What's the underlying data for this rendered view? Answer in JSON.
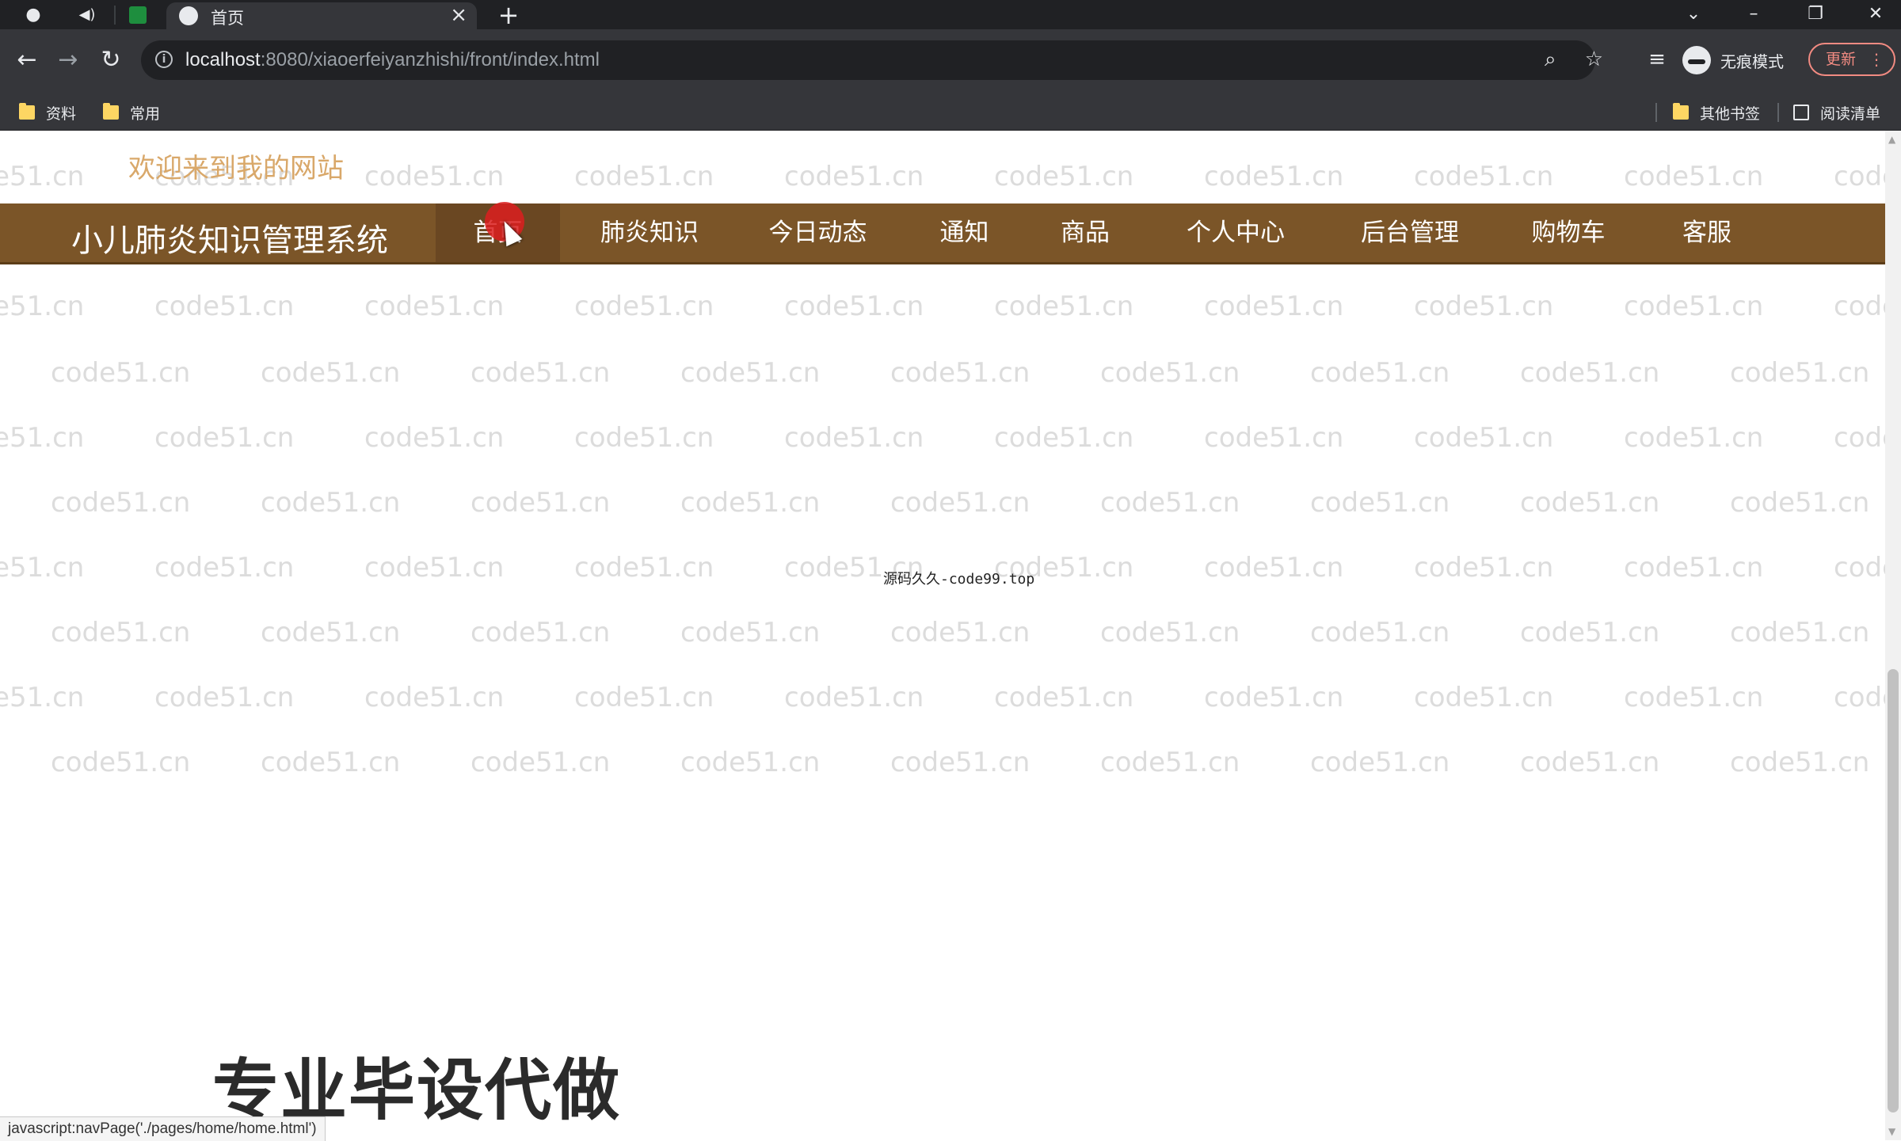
{
  "browser": {
    "tab_title": "首页",
    "url_host": "localhost",
    "url_rest": ":8080/xiaoerfeiyanzhishi/front/index.html",
    "profile_label": "无痕模式",
    "update_label": "更新",
    "bookmarks": [
      "资料",
      "常用"
    ],
    "other_bookmarks": "其他书签",
    "reading_list": "阅读清单"
  },
  "page": {
    "welcome": "欢迎来到我的网站",
    "brand": "小儿肺炎知识管理系统",
    "nav": [
      "首页",
      "肺炎知识",
      "今日动态",
      "通知",
      "商品",
      "个人中心",
      "后台管理",
      "购物车",
      "客服"
    ],
    "active_nav": "首页",
    "center_text": "源码久久-code99.top",
    "watermark": "code51.cn",
    "promo": "专业毕设代做",
    "status_url": "javascript:navPage('./pages/home/home.html')"
  },
  "colors": {
    "nav_bg": "#7b5528",
    "welcome": "#d9a86a",
    "watermark": "#dcdcdc"
  }
}
